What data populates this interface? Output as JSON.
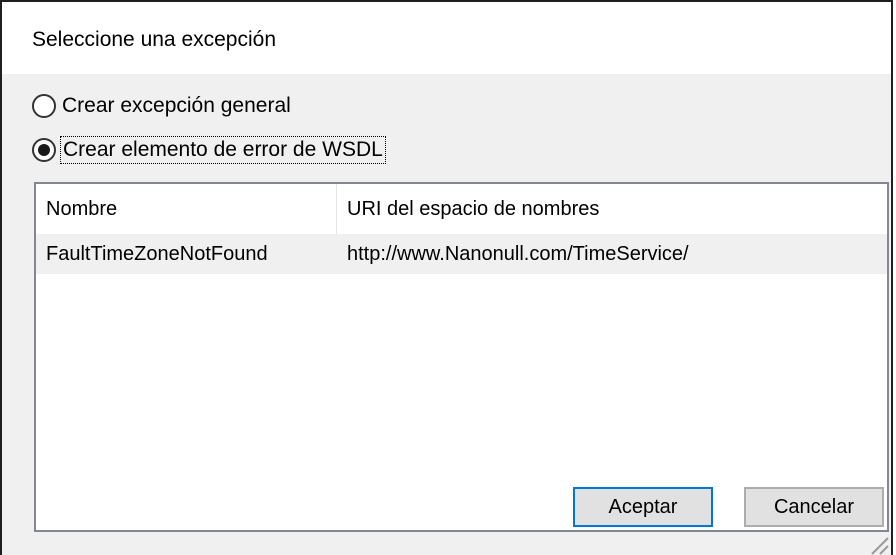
{
  "dialog": {
    "title": "Seleccione una excepción"
  },
  "options": [
    {
      "label": "Crear excepción general",
      "checked": false
    },
    {
      "label": "Crear elemento de error de WSDL",
      "checked": true
    }
  ],
  "table": {
    "columns": [
      "Nombre",
      "URI del espacio de nombres"
    ],
    "rows": [
      [
        "FaultTimeZoneNotFound",
        "http://www.Nanonull.com/TimeService/"
      ]
    ]
  },
  "buttons": {
    "ok": "Aceptar",
    "cancel": "Cancelar"
  }
}
